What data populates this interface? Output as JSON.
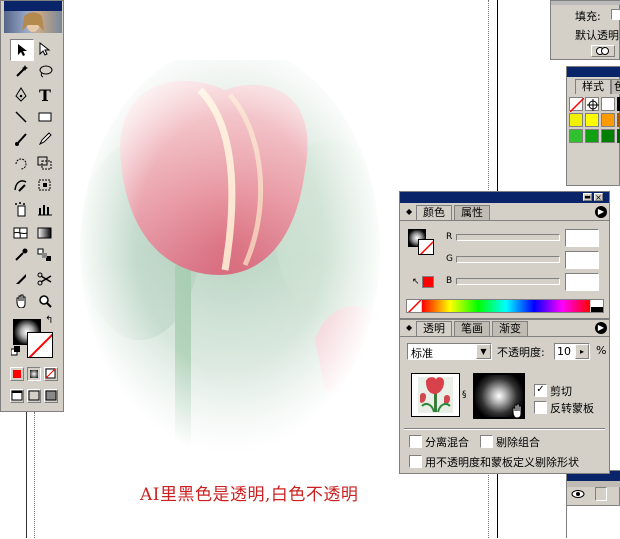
{
  "caption": "AI里黑色是透明,白色不透明",
  "colors": {
    "caption": "#cc2020",
    "panel_face": "#d4d0c8",
    "titlebar": "#0a246a",
    "red_fill": "#ff0000"
  },
  "top_right_panel": {
    "fill_label": "填充:",
    "default_opacity_label": "默认透明"
  },
  "styles_panel": {
    "tab_label": "样式",
    "tab_label_2": "色"
  },
  "tools": {
    "rows": [
      [
        "selection-arrow-icon",
        "direct-select-icon"
      ],
      [
        "magic-wand-icon",
        "lasso-icon"
      ],
      [
        "pen-icon",
        "type-icon"
      ],
      [
        "line-icon",
        "rectangle-icon"
      ],
      [
        "paintbrush-icon",
        "pencil-icon"
      ],
      [
        "rotate-icon",
        "scale-icon"
      ],
      [
        "warp-icon",
        "free-transform-icon"
      ],
      [
        "symbol-sprayer-icon",
        "graph-icon"
      ],
      [
        "mesh-icon",
        "gradient-icon"
      ],
      [
        "eyedropper-icon",
        "blend-icon"
      ],
      [
        "slice-icon",
        "scissors-icon"
      ],
      [
        "hand-icon",
        "zoom-icon"
      ]
    ]
  },
  "color_panel": {
    "tabs": [
      "颜色",
      "属性"
    ],
    "channels": [
      {
        "label": "R",
        "value": ""
      },
      {
        "label": "G",
        "value": ""
      },
      {
        "label": "B",
        "value": ""
      }
    ]
  },
  "transparency_panel": {
    "tabs": [
      "透明",
      "笔画",
      "渐变"
    ],
    "blend_mode": "标准",
    "opacity_label": "不透明度:",
    "opacity_value": "10",
    "percent_sign": "%",
    "clip_label": "剪切",
    "clip_checked": true,
    "invert_mask_label": "反转蒙板",
    "invert_mask_checked": false,
    "isolate_blending_label": "分离混合",
    "knockout_group_label": "剔除组合",
    "opacity_mask_label": "用不透明度和蒙板定义剔除形状"
  }
}
